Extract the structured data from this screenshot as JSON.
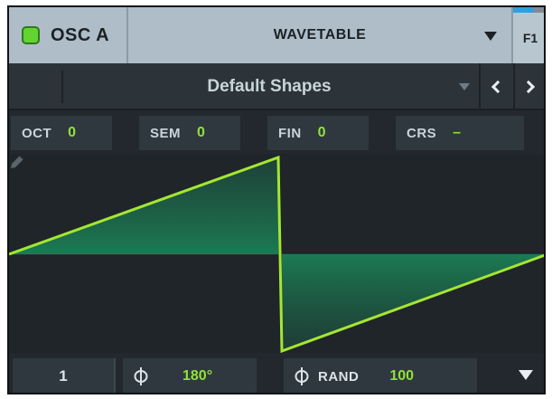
{
  "header": {
    "osc_label": "OSC A",
    "osc_enabled": true,
    "osc_type": "WAVETABLE",
    "fx_tab_label": "F1"
  },
  "preset": {
    "name": "Default Shapes"
  },
  "tuning": [
    {
      "name": "OCT",
      "value": "0"
    },
    {
      "name": "SEM",
      "value": "0"
    },
    {
      "name": "FIN",
      "value": "0"
    },
    {
      "name": "CRS",
      "value": "–"
    }
  ],
  "bottom": {
    "unison_voices": "1",
    "phase_value": "180°",
    "rand_label": "RAND",
    "rand_value": "100"
  },
  "colors": {
    "accent_green": "#8fe23a",
    "led_green": "#63d431",
    "wave_line": "#a5e632",
    "fx_tab_blue": "#2aa0e6"
  },
  "icons": {
    "edit": "pencil-icon",
    "phase": "phase-icon",
    "prev": "chevron-left-icon",
    "next": "chevron-right-icon",
    "menu": "triangle-down-icon"
  }
}
